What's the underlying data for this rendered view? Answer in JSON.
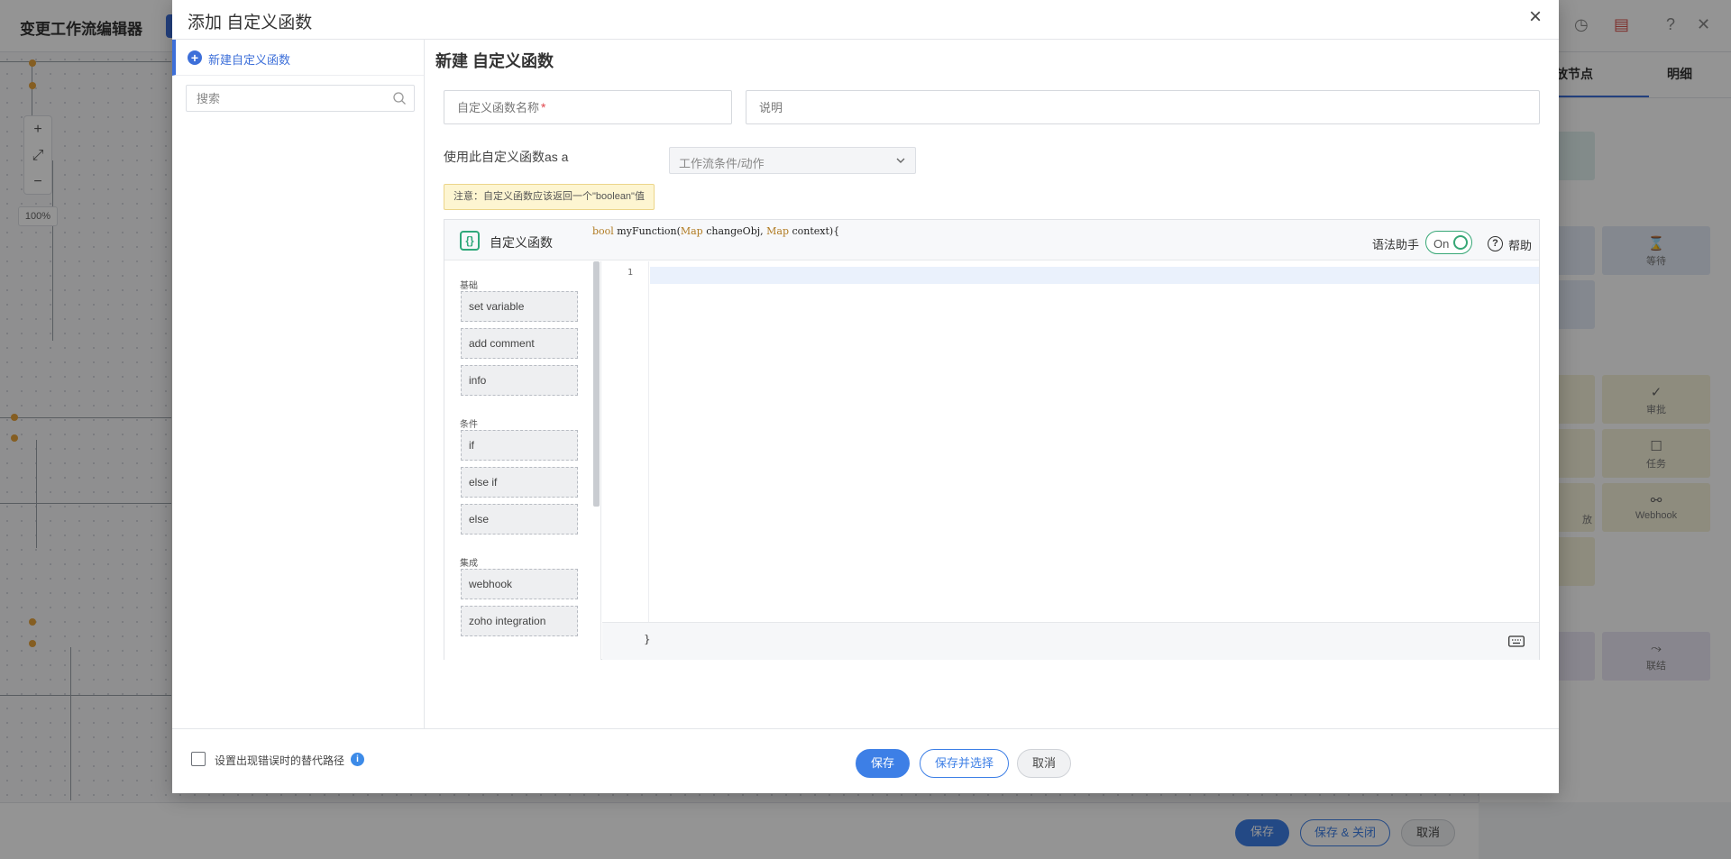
{
  "background": {
    "title": "变更工作流编辑器",
    "right_tabs": [
      "放节点",
      "明细"
    ],
    "tiles": [
      {
        "label": "等待",
        "icon": "⌛"
      },
      {
        "label": "审批",
        "icon": "✓"
      },
      {
        "label": "任务",
        "icon": "☐"
      },
      {
        "label": "Webhook",
        "icon": "⚯"
      },
      {
        "label": "联结",
        "icon": "⤳"
      },
      {
        "label": "放",
        "icon": ""
      }
    ],
    "zoom_level": "100%",
    "footer_buttons": {
      "save": "保存",
      "save_close": "保存 & 关闭",
      "cancel": "取消"
    }
  },
  "modal": {
    "title": "添加 自定义函数",
    "close_icon": "close-icon",
    "left": {
      "new_item_label": "新建自定义函数",
      "search_placeholder": "搜索"
    },
    "main": {
      "title": "新建 自定义函数",
      "name_placeholder": "自定义函数名称",
      "required_mark": "*",
      "description_placeholder": "说明",
      "use_as_label": "使用此自定义函数as a",
      "use_as_value": "工作流条件/动作",
      "note": "注意：自定义函数应该返回一个\"boolean\"值"
    },
    "editor": {
      "label": "自定义函数",
      "signature": {
        "ret": "bool",
        "name": " myFunction",
        "open": "(",
        "type1": "Map",
        "arg1": " changeObj,",
        "type2": " Map",
        "arg2": " context",
        "close": ")",
        "brace": "{"
      },
      "syntax_helper_label": "语法助手",
      "toggle_state": "On",
      "help_label": "帮助",
      "line_numbers": [
        "1"
      ],
      "closing_brace": "}",
      "palette": {
        "categories": [
          {
            "name": "基础",
            "items": [
              "set variable",
              "add comment",
              "info"
            ]
          },
          {
            "name": "条件",
            "items": [
              "if",
              "else if",
              "else"
            ]
          },
          {
            "name": "集成",
            "items": [
              "webhook",
              "zoho integration"
            ]
          }
        ]
      }
    },
    "footer": {
      "checkbox_label": "设置出现错误时的替代路径",
      "save": "保存",
      "save_select": "保存并选择",
      "cancel": "取消"
    }
  },
  "colors": {
    "accent": "#3d7fe6",
    "toggle_green": "#37a776",
    "note_bg": "#fdf5d1",
    "required": "#e0464d"
  }
}
